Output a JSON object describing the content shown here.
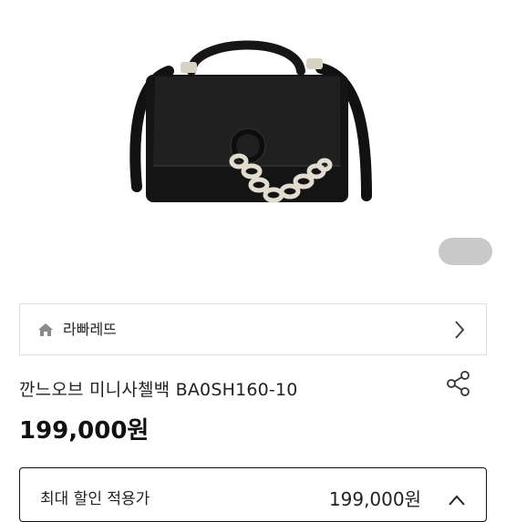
{
  "brand": {
    "name": "라빠레뜨"
  },
  "product": {
    "name": "깐느오브 미니사첼백 BA0SH160-10",
    "price": "199,000원"
  },
  "discount": {
    "label": "최대 할인 적용가",
    "price": "199,000원"
  },
  "icons": {
    "home": "home-icon",
    "chevron_right": "chevron-right-icon",
    "share": "share-icon",
    "chevron_up": "chevron-up-icon"
  },
  "colors": {
    "bag": "#1a1a1a",
    "pager": "#c9c9c9",
    "border": "#dedede"
  }
}
